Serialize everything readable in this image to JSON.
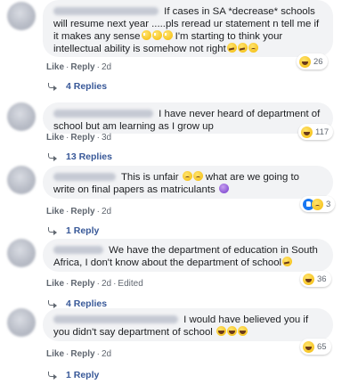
{
  "comments": [
    {
      "author": "",
      "text_parts": [
        "If cases in SA *decrease* schools will resume next year .....pls reread ur statement n tell me if it makes any sense",
        "I'm starting to think your intellectual ability is somehow not right"
      ],
      "emojis_inline_1": [
        "eyes-emoji",
        "eyes-emoji",
        "eyes-emoji"
      ],
      "emojis_inline_2": [
        "think-emoji",
        "think-emoji",
        "sad-emoji"
      ],
      "like": "Like",
      "reply": "Reply",
      "time": "2d",
      "reaction_icons": [
        "haha-icon"
      ],
      "reaction_count": "26",
      "replies": "4 Replies"
    },
    {
      "author": "",
      "text": "I have never heard of department of school but am learning as I grow up",
      "like": "Like",
      "reply": "Reply",
      "time": "3d",
      "reaction_icons": [
        "haha-icon"
      ],
      "reaction_count": "117",
      "replies": "13 Replies"
    },
    {
      "author": "",
      "text_a": "This is unfair",
      "text_b": "what are we going to write on final papers as matriculants",
      "emojis_inline_1": [
        "sad-emoji",
        "sad-emoji"
      ],
      "emojis_inline_2": [
        "purple-emoji"
      ],
      "like": "Like",
      "reply": "Reply",
      "time": "2d",
      "reaction_icons": [
        "like-icon",
        "sad-icon"
      ],
      "reaction_count": "3",
      "replies": "1 Reply"
    },
    {
      "author": "",
      "text": "We have the department of education in South Africa, I don't know about the department of school",
      "emojis_inline_1": [
        "think-emoji"
      ],
      "like": "Like",
      "reply": "Reply",
      "time": "2d",
      "edited": "Edited",
      "reaction_icons": [
        "haha-icon"
      ],
      "reaction_count": "36",
      "replies": "4 Replies"
    },
    {
      "author": "",
      "text": "I would have believed you if you didn't say department of school",
      "emojis_inline_1": [
        "laugh-emoji",
        "laugh-emoji",
        "laugh-emoji"
      ],
      "like": "Like",
      "reply": "Reply",
      "time": "2d",
      "reaction_icons": [
        "haha-icon"
      ],
      "reaction_count": "65",
      "replies": "1 Reply"
    }
  ],
  "colors": {
    "bubble": "#f2f3f5",
    "link": "#385898",
    "meta": "#606770",
    "text": "#1c1e21"
  }
}
